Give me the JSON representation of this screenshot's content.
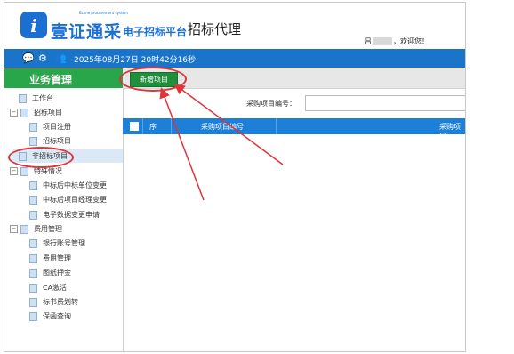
{
  "header": {
    "brand": "壹证通采",
    "brand_sub": "Ezhne procurement system",
    "platform": "电子招标平台",
    "module": "招标代理",
    "user_prefix": "吕",
    "greeting": "，欢迎您！"
  },
  "toolbar": {
    "icons": [
      "chat-icon",
      "gear-icon",
      "users-icon"
    ],
    "datetime": "2025年08月27日 20时42分16秒"
  },
  "sidebar": {
    "title": "业务管理",
    "items": [
      {
        "label": "工作台",
        "type": "leaf",
        "level": 0
      },
      {
        "label": "招标项目",
        "type": "folder",
        "level": 0,
        "expanded": true
      },
      {
        "label": "项目注册",
        "type": "leaf",
        "level": 1
      },
      {
        "label": "招标项目",
        "type": "leaf",
        "level": 1
      },
      {
        "label": "非招标项目",
        "type": "leaf",
        "level": 0,
        "selected": true
      },
      {
        "label": "特殊情况",
        "type": "folder",
        "level": 0,
        "expanded": true
      },
      {
        "label": "中标后中标单位变更",
        "type": "leaf",
        "level": 1
      },
      {
        "label": "中标后项目经理变更",
        "type": "leaf",
        "level": 1
      },
      {
        "label": "电子数据变更申请",
        "type": "leaf",
        "level": 1
      },
      {
        "label": "费用管理",
        "type": "folder",
        "level": 0,
        "expanded": true
      },
      {
        "label": "银行账号管理",
        "type": "leaf",
        "level": 1
      },
      {
        "label": "费用管理",
        "type": "leaf",
        "level": 1
      },
      {
        "label": "图纸押金",
        "type": "leaf",
        "level": 1
      },
      {
        "label": "CA激活",
        "type": "leaf",
        "level": 1
      },
      {
        "label": "标书费划转",
        "type": "leaf",
        "level": 1
      },
      {
        "label": "保函查询",
        "type": "leaf",
        "level": 1
      }
    ]
  },
  "main": {
    "new_button": "新增项目",
    "search_label": "采购项目编号：",
    "search_value": "",
    "table_headers": [
      "序",
      "采购项目编号",
      "采购项目"
    ]
  },
  "colors": {
    "brand_blue": "#1a6fd1",
    "toolbar_blue": "#1a74c9",
    "sidebar_green": "#2aa64a",
    "button_green": "#1f8f3c",
    "table_header_blue": "#1d7fd8",
    "annotation_red": "#e0343a"
  }
}
